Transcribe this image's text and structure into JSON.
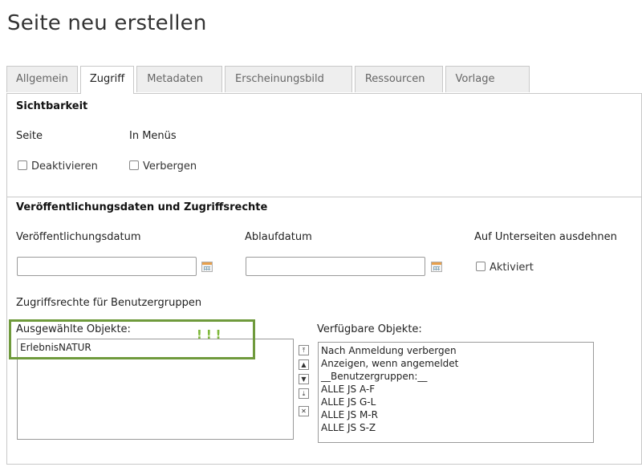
{
  "page": {
    "title": "Seite neu erstellen"
  },
  "tabs": [
    {
      "label": "Allgemein",
      "active": false
    },
    {
      "label": "Zugriff",
      "active": true
    },
    {
      "label": "Metadaten",
      "active": false
    },
    {
      "label": "Erscheinungsbild",
      "active": false
    },
    {
      "label": "Ressourcen",
      "active": false
    },
    {
      "label": "Vorlage",
      "active": false
    }
  ],
  "visibility": {
    "heading": "Sichtbarkeit",
    "page_label": "Seite",
    "menu_label": "In Menüs",
    "disable_label": "Deaktivieren",
    "hide_label": "Verbergen"
  },
  "publishing": {
    "heading": "Veröffentlichungsdaten und Zugriffsrechte",
    "publish_date_label": "Veröffentlichungsdatum",
    "publish_date_value": "",
    "expiry_date_label": "Ablaufdatum",
    "expiry_date_value": "",
    "extend_label": "Auf Unterseiten ausdehnen",
    "activated_label": "Aktiviert",
    "groups_label": "Zugriffsrechte für Benutzergruppen",
    "selected_label": "Ausgewählte Objekte:",
    "available_label": "Verfügbare Objekte:",
    "selected_items": [
      "ErlebnisNATUR"
    ],
    "available_items": [
      "Nach Anmeldung verbergen",
      "Anzeigen, wenn angemeldet",
      "__Benutzergruppen:__",
      "ALLE JS A-F",
      "ALLE JS G-L",
      "ALLE JS M-R",
      "ALLE JS S-Z"
    ]
  },
  "annotation": {
    "marker": "!!!",
    "color": "#6f9a3c"
  }
}
